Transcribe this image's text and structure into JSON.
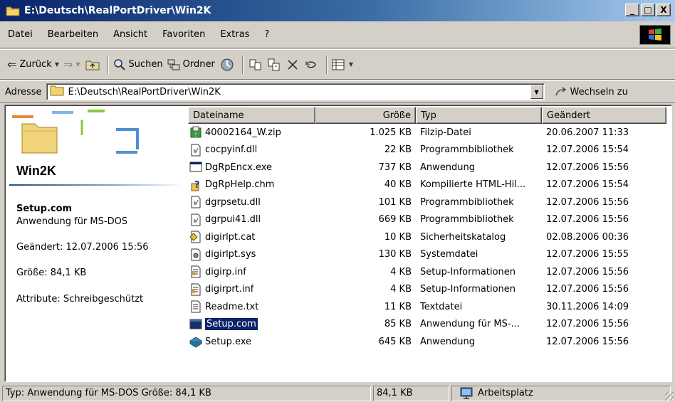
{
  "window": {
    "title": "E:\\Deutsch\\RealPortDriver\\Win2K",
    "buttons": {
      "minimize": "_",
      "maximize": "□",
      "close": "X"
    }
  },
  "menubar": {
    "items": [
      "Datei",
      "Bearbeiten",
      "Ansicht",
      "Favoriten",
      "Extras",
      "?"
    ]
  },
  "toolbar": {
    "back": "Zurück",
    "search": "Suchen",
    "folders": "Ordner"
  },
  "address": {
    "label": "Adresse",
    "value": "E:\\Deutsch\\RealPortDriver\\Win2K",
    "go": "Wechseln zu"
  },
  "leftpane": {
    "folder_title": "Win2K",
    "selected_name": "Setup.com",
    "selected_type": "Anwendung für MS-DOS",
    "modified": "Geändert: 12.07.2006 15:56",
    "size": "Größe: 84,1 KB",
    "attributes": "Attribute: Schreibgeschützt"
  },
  "columns": {
    "name": "Dateiname",
    "size": "Größe",
    "type": "Typ",
    "date": "Geändert"
  },
  "files": [
    {
      "name": "40002164_W.zip",
      "size": "1.025 KB",
      "type": "Filzip-Datei",
      "date": "20.06.2007 11:33",
      "icon": "zip-icon"
    },
    {
      "name": "cocpyinf.dll",
      "size": "22 KB",
      "type": "Programmbibliothek",
      "date": "12.07.2006 15:54",
      "icon": "dll-icon"
    },
    {
      "name": "DgRpEncx.exe",
      "size": "737 KB",
      "type": "Anwendung",
      "date": "12.07.2006 15:56",
      "icon": "exe-icon"
    },
    {
      "name": "DgRpHelp.chm",
      "size": "40 KB",
      "type": "Kompilierte HTML-Hil...",
      "date": "12.07.2006 15:54",
      "icon": "chm-icon"
    },
    {
      "name": "dgrpsetu.dll",
      "size": "101 KB",
      "type": "Programmbibliothek",
      "date": "12.07.2006 15:56",
      "icon": "dll-icon"
    },
    {
      "name": "dgrpui41.dll",
      "size": "669 KB",
      "type": "Programmbibliothek",
      "date": "12.07.2006 15:56",
      "icon": "dll-icon"
    },
    {
      "name": "digirlpt.cat",
      "size": "10 KB",
      "type": "Sicherheitskatalog",
      "date": "02.08.2006 00:36",
      "icon": "cat-icon"
    },
    {
      "name": "digirlpt.sys",
      "size": "130 KB",
      "type": "Systemdatei",
      "date": "12.07.2006 15:55",
      "icon": "sys-icon"
    },
    {
      "name": "digirp.inf",
      "size": "4 KB",
      "type": "Setup-Informationen",
      "date": "12.07.2006 15:56",
      "icon": "inf-icon"
    },
    {
      "name": "digirprt.inf",
      "size": "4 KB",
      "type": "Setup-Informationen",
      "date": "12.07.2006 15:56",
      "icon": "inf-icon"
    },
    {
      "name": "Readme.txt",
      "size": "11 KB",
      "type": "Textdatei",
      "date": "30.11.2006 14:09",
      "icon": "txt-icon"
    },
    {
      "name": "Setup.com",
      "size": "85 KB",
      "type": "Anwendung für MS-...",
      "date": "12.07.2006 15:56",
      "icon": "com-icon",
      "selected": true
    },
    {
      "name": "Setup.exe",
      "size": "645 KB",
      "type": "Anwendung",
      "date": "12.07.2006 15:56",
      "icon": "setup-exe-icon"
    }
  ],
  "statusbar": {
    "info": "Typ: Anwendung für MS-DOS Größe: 84,1 KB",
    "size": "84,1 KB",
    "zone": "Arbeitsplatz"
  },
  "colors": {
    "title_start": "#0a246a",
    "title_end": "#a6caf0",
    "selection": "#0a246a",
    "chrome": "#d4d0c8"
  }
}
